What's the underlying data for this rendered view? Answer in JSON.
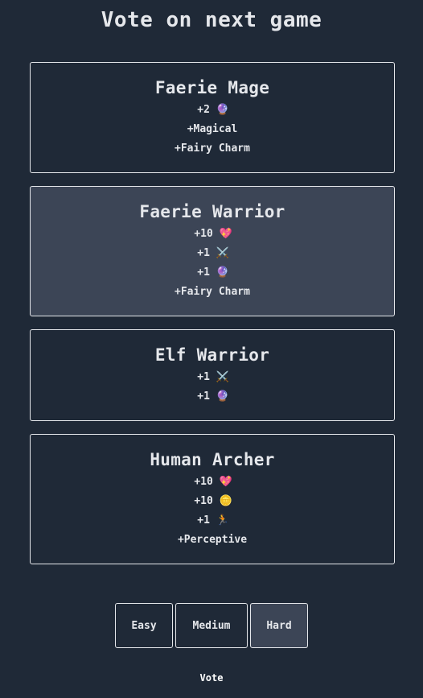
{
  "title": "Vote on next game",
  "options": [
    {
      "name": "Faerie Mage",
      "selected": false,
      "lines": [
        {
          "text": "+2",
          "icon": "crystal-ball-icon",
          "glyph": "🔮"
        },
        {
          "text": "+Magical"
        },
        {
          "text": "+Fairy Charm"
        }
      ]
    },
    {
      "name": "Faerie Warrior",
      "selected": true,
      "lines": [
        {
          "text": "+10",
          "icon": "heart-icon",
          "glyph": "💖"
        },
        {
          "text": "+1",
          "icon": "crossed-swords-icon",
          "glyph": "⚔️"
        },
        {
          "text": "+1",
          "icon": "crystal-ball-icon",
          "glyph": "🔮"
        },
        {
          "text": "+Fairy Charm"
        }
      ]
    },
    {
      "name": "Elf Warrior",
      "selected": false,
      "lines": [
        {
          "text": "+1",
          "icon": "crossed-swords-icon",
          "glyph": "⚔️"
        },
        {
          "text": "+1",
          "icon": "crystal-ball-icon",
          "glyph": "🔮"
        }
      ]
    },
    {
      "name": "Human Archer",
      "selected": false,
      "lines": [
        {
          "text": "+10",
          "icon": "heart-icon",
          "glyph": "💖"
        },
        {
          "text": "+10",
          "icon": "coin-icon",
          "glyph": "🪙"
        },
        {
          "text": "+1",
          "icon": "running-person-icon",
          "glyph": "🏃"
        },
        {
          "text": "+Perceptive"
        }
      ]
    }
  ],
  "difficulty": {
    "easy_label": "Easy",
    "medium_label": "Medium",
    "hard_label": "Hard",
    "selected": "Hard"
  },
  "vote_label": "Vote",
  "colors": {
    "background": "#1f2937",
    "selected_card": "#3c4556",
    "border": "#e5e7eb",
    "text": "#e5e7eb"
  }
}
